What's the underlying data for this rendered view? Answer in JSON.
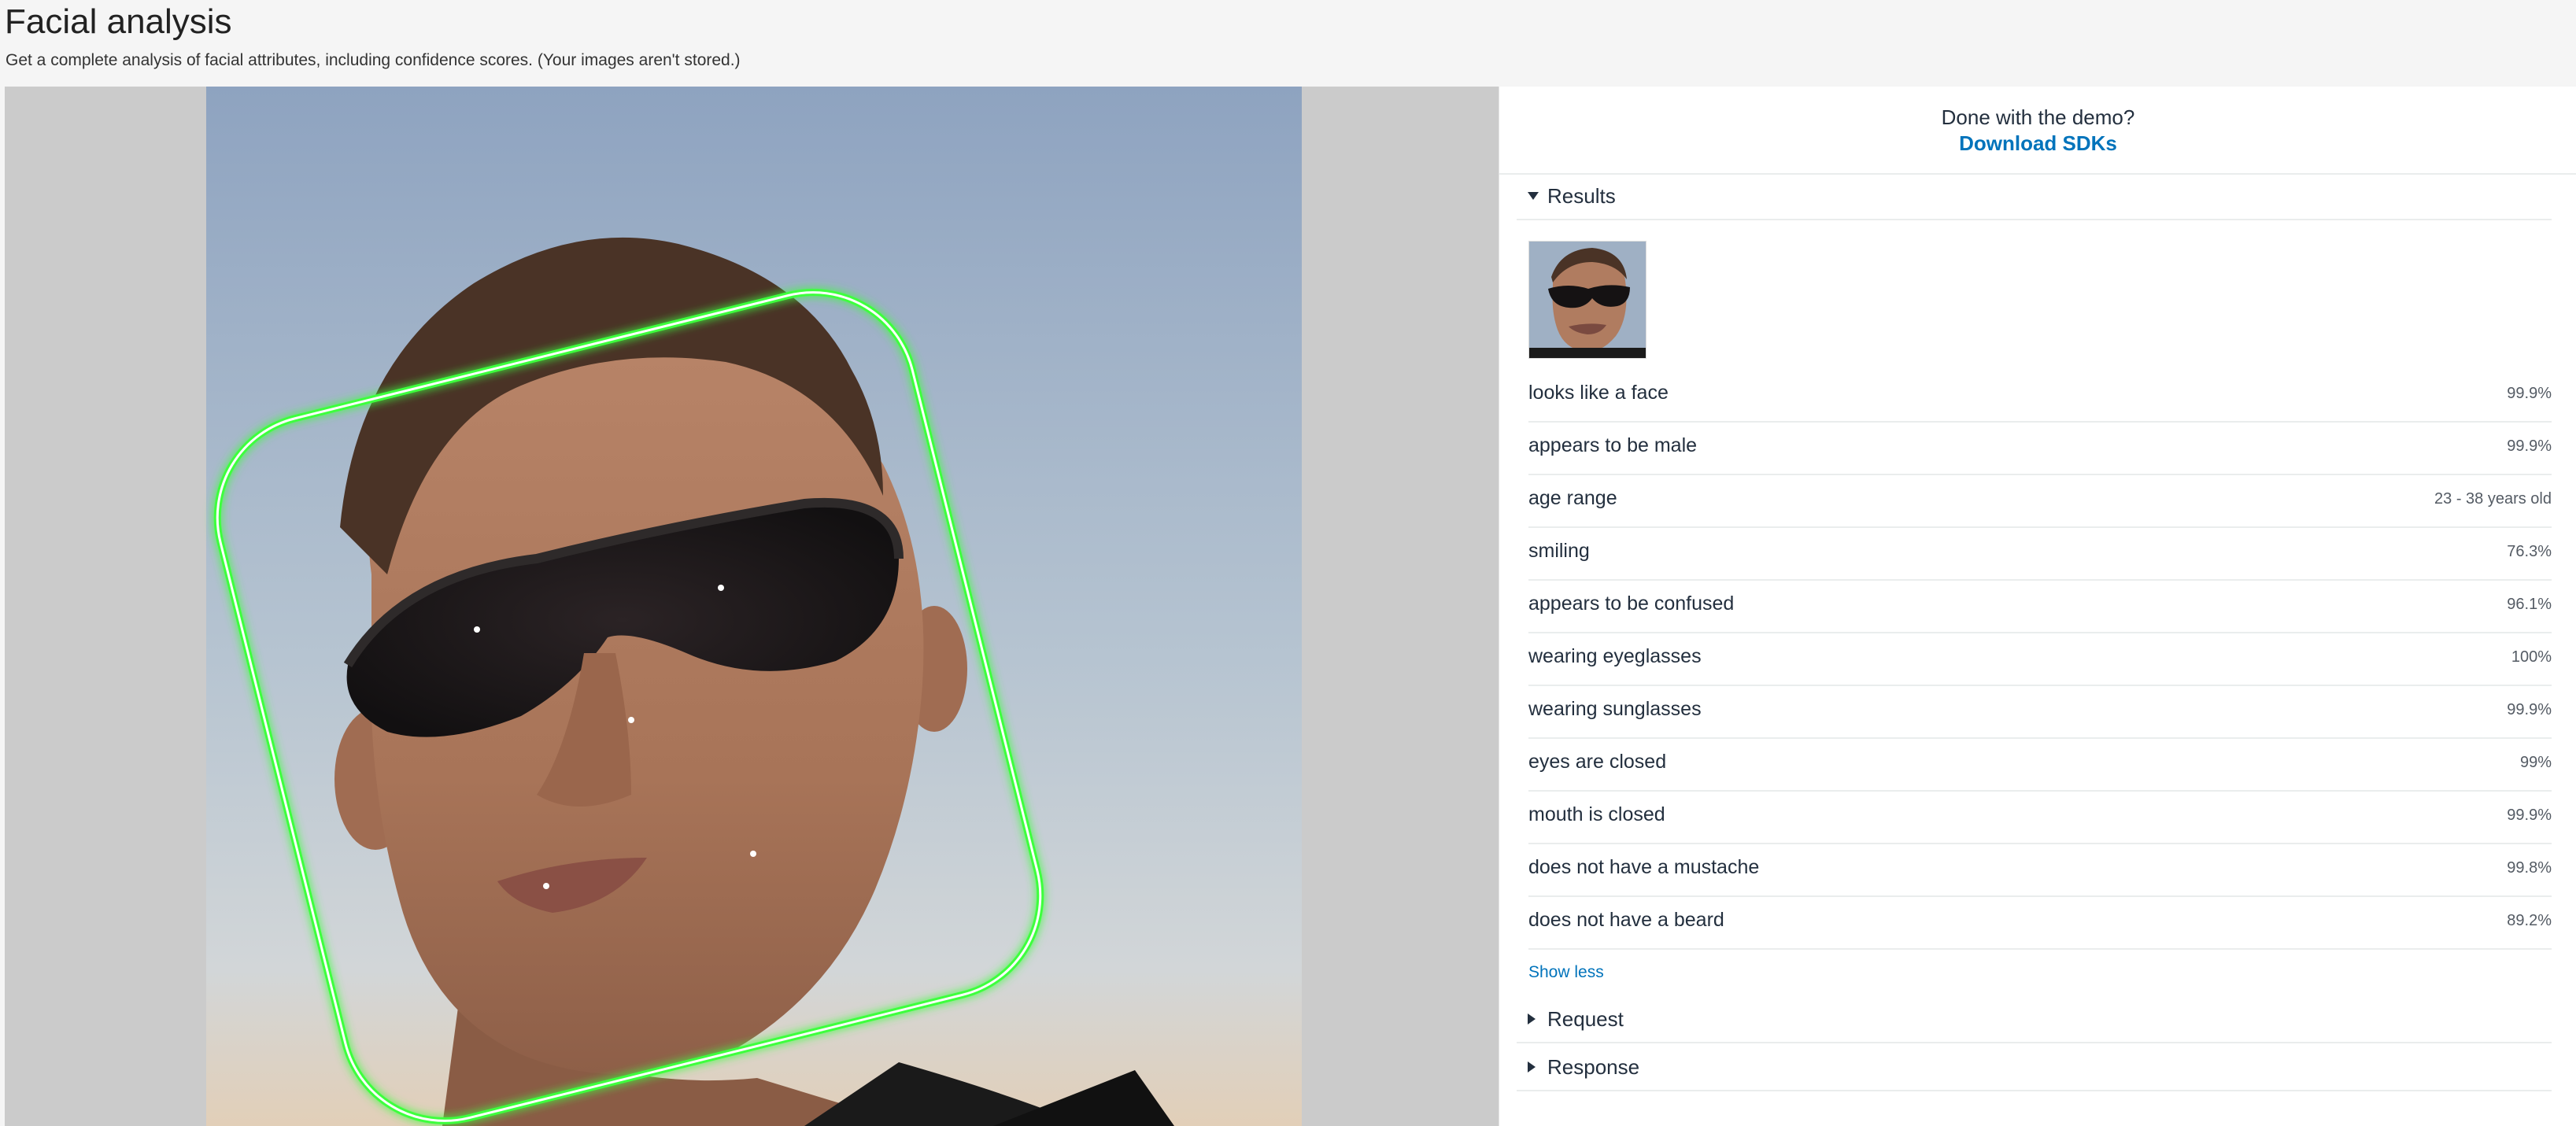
{
  "page": {
    "title": "Facial analysis",
    "subtitle": "Get a complete analysis of facial attributes, including confidence scores. (Your images aren't stored.)"
  },
  "demo": {
    "prompt": "Done with the demo?",
    "link": "Download SDKs"
  },
  "sections": {
    "results": "Results",
    "request": "Request",
    "response": "Response"
  },
  "results": [
    {
      "attribute": "looks like a face",
      "confidence": "99.9%"
    },
    {
      "attribute": "appears to be male",
      "confidence": "99.9%"
    },
    {
      "attribute": "age range",
      "confidence": "23 - 38 years old"
    },
    {
      "attribute": "smiling",
      "confidence": "76.3%"
    },
    {
      "attribute": "appears to be confused",
      "confidence": "96.1%"
    },
    {
      "attribute": "wearing eyeglasses",
      "confidence": "100%"
    },
    {
      "attribute": "wearing sunglasses",
      "confidence": "99.9%"
    },
    {
      "attribute": "eyes are closed",
      "confidence": "99%"
    },
    {
      "attribute": "mouth is closed",
      "confidence": "99.9%"
    },
    {
      "attribute": "does not have a mustache",
      "confidence": "99.8%"
    },
    {
      "attribute": "does not have a beard",
      "confidence": "89.2%"
    }
  ],
  "show_less": "Show less",
  "colors": {
    "accent": "#0073bb",
    "face_box": "#3dff3d",
    "panel_bg": "#cbcbcb"
  },
  "icons": {
    "results_toggle": "caret-down-icon",
    "request_toggle": "caret-right-icon",
    "response_toggle": "caret-right-icon"
  }
}
